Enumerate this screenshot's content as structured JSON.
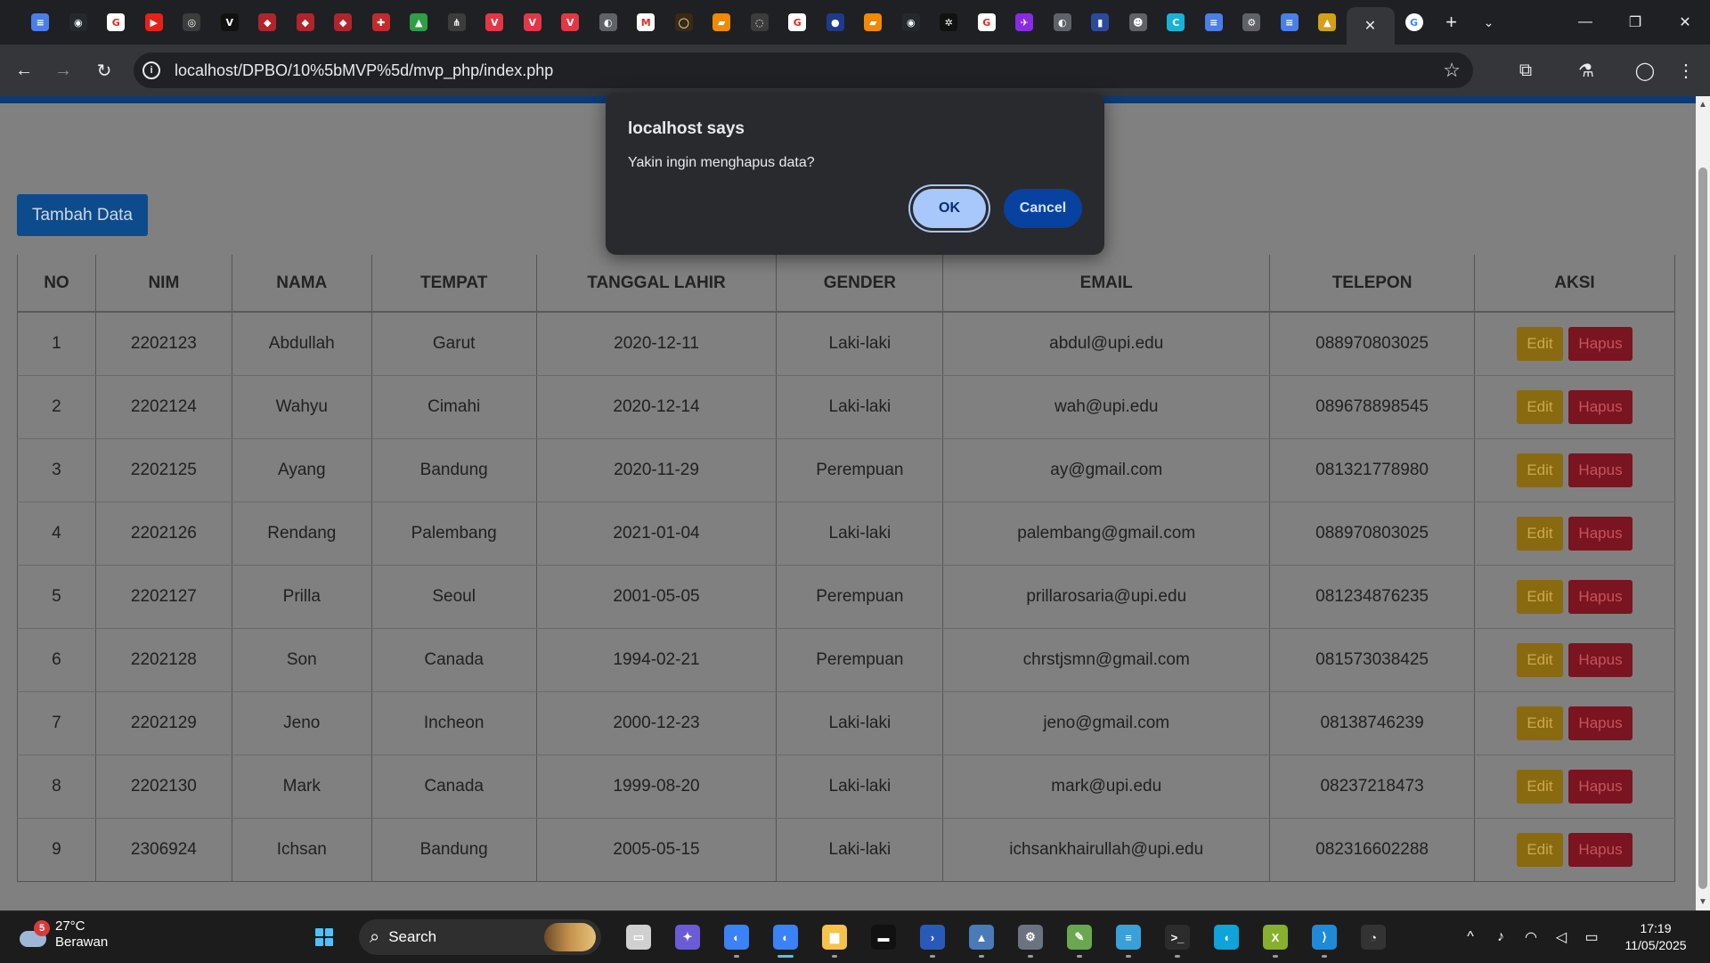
{
  "browser": {
    "tab_favicons": [
      {
        "name": "docs-tab",
        "color": "#4a7ee8",
        "glyph": "≡"
      },
      {
        "name": "github-tab",
        "color": "#24292e",
        "glyph": "◉"
      },
      {
        "name": "google-tab",
        "color": "#ffffff",
        "glyph": "G"
      },
      {
        "name": "youtube-tab",
        "color": "#e62117",
        "glyph": "▶"
      },
      {
        "name": "gray-circle-tab",
        "color": "#3c3c3c",
        "glyph": "◎"
      },
      {
        "name": "vo-tab",
        "color": "#111111",
        "glyph": "V"
      },
      {
        "name": "upi-tab-1",
        "color": "#b0242c",
        "glyph": "◆"
      },
      {
        "name": "upi-tab-2",
        "color": "#b0242c",
        "glyph": "◆"
      },
      {
        "name": "upi-tab-3",
        "color": "#b0242c",
        "glyph": "◆"
      },
      {
        "name": "gift-tab",
        "color": "#c22b2b",
        "glyph": "✚"
      },
      {
        "name": "drive-tab",
        "color": "#2f9e44",
        "glyph": "▲"
      },
      {
        "name": "graph-tab",
        "color": "#3c3c3c",
        "glyph": "⋔"
      },
      {
        "name": "v-red-tab-1",
        "color": "#e23744",
        "glyph": "V"
      },
      {
        "name": "v-red-tab-2",
        "color": "#e23744",
        "glyph": "V"
      },
      {
        "name": "v-red-tab-3",
        "color": "#e23744",
        "glyph": "V"
      },
      {
        "name": "globe-tab",
        "color": "#5f6368",
        "glyph": "◐"
      },
      {
        "name": "gmail-tab",
        "color": "#ffffff",
        "glyph": "M"
      },
      {
        "name": "orange-ring-tab",
        "color": "#3a2a10",
        "glyph": "◯"
      },
      {
        "name": "orange-tab-1",
        "color": "#f08a00",
        "glyph": "▰"
      },
      {
        "name": "ring-tab",
        "color": "#3c3c3c",
        "glyph": "◌"
      },
      {
        "name": "google-tab-2",
        "color": "#ffffff",
        "glyph": "G"
      },
      {
        "name": "blue-circle-tab",
        "color": "#1e3a8a",
        "glyph": "●"
      },
      {
        "name": "orange-tab-2",
        "color": "#f08a00",
        "glyph": "▰"
      },
      {
        "name": "github-tab-2",
        "color": "#24292e",
        "glyph": "◉"
      },
      {
        "name": "openai-tab",
        "color": "#111111",
        "glyph": "✲"
      },
      {
        "name": "google-tab-3",
        "color": "#ffffff",
        "glyph": "G"
      },
      {
        "name": "bird-tab",
        "color": "#8a2be2",
        "glyph": "✈"
      },
      {
        "name": "globe-tab-2",
        "color": "#5f6368",
        "glyph": "◐"
      },
      {
        "name": "split-tab",
        "color": "#2b4a9b",
        "glyph": "▮"
      },
      {
        "name": "cat-tab",
        "color": "#5f6368",
        "glyph": "☻"
      },
      {
        "name": "canva-tab",
        "color": "#19b2d6",
        "glyph": "C"
      },
      {
        "name": "docs-tab-2",
        "color": "#4a7ee8",
        "glyph": "≡"
      },
      {
        "name": "settings-tab",
        "color": "#5f6368",
        "glyph": "⚙"
      },
      {
        "name": "docs-tab-3",
        "color": "#4a7ee8",
        "glyph": "≡"
      },
      {
        "name": "warning-tab",
        "color": "#d4a017",
        "glyph": "▲"
      }
    ],
    "active_tab_close": "✕",
    "after_tab_glyph": "G",
    "new_tab": "+",
    "tab_search": "⌄",
    "win_min": "—",
    "win_max": "❐",
    "win_close": "✕",
    "url": "localhost/DPBO/10%5bMVP%5d/mvp_php/index.php",
    "back": "←",
    "forward": "→",
    "reload": "↻",
    "star": "☆",
    "extensions": "⧉",
    "labs": "⚗",
    "profile": "◯",
    "menu": "⋮"
  },
  "page": {
    "add_button": "Tambah Data",
    "headers": [
      "NO",
      "NIM",
      "NAMA",
      "TEMPAT",
      "TANGGAL LAHIR",
      "GENDER",
      "EMAIL",
      "TELEPON",
      "AKSI"
    ],
    "rows": [
      [
        "1",
        "2202123",
        "Abdullah",
        "Garut",
        "2020-12-11",
        "Laki-laki",
        "abdul@upi.edu",
        "088970803025"
      ],
      [
        "2",
        "2202124",
        "Wahyu",
        "Cimahi",
        "2020-12-14",
        "Laki-laki",
        "wah@upi.edu",
        "089678898545"
      ],
      [
        "3",
        "2202125",
        "Ayang",
        "Bandung",
        "2020-11-29",
        "Perempuan",
        "ay@gmail.com",
        "081321778980"
      ],
      [
        "4",
        "2202126",
        "Rendang",
        "Palembang",
        "2021-01-04",
        "Laki-laki",
        "palembang@gmail.com",
        "088970803025"
      ],
      [
        "5",
        "2202127",
        "Prilla",
        "Seoul",
        "2001-05-05",
        "Perempuan",
        "prillarosaria@upi.edu",
        "081234876235"
      ],
      [
        "6",
        "2202128",
        "Son",
        "Canada",
        "1994-02-21",
        "Perempuan",
        "chrstjsmn@gmail.com",
        "081573038425"
      ],
      [
        "7",
        "2202129",
        "Jeno",
        "Incheon",
        "2000-12-23",
        "Laki-laki",
        "jeno@gmail.com",
        "08138746239"
      ],
      [
        "8",
        "2202130",
        "Mark",
        "Canada",
        "1999-08-20",
        "Laki-laki",
        "mark@upi.edu",
        "08237218473"
      ],
      [
        "9",
        "2306924",
        "Ichsan",
        "Bandung",
        "2005-05-15",
        "Laki-laki",
        "ichsankhairullah@upi.edu",
        "082316602288"
      ]
    ],
    "edit_label": "Edit",
    "delete_label": "Hapus"
  },
  "dialog": {
    "title": "localhost says",
    "message": "Yakin ingin menghapus data?",
    "ok": "OK",
    "cancel": "Cancel"
  },
  "taskbar": {
    "weather_badge": "5",
    "temperature": "27°C",
    "condition": "Berawan",
    "search": "Search",
    "apps": [
      {
        "name": "task-view",
        "color": "#d0d0d0",
        "glyph": "▭",
        "dot": false
      },
      {
        "name": "copilot",
        "color": "#6b5bd6",
        "glyph": "✦",
        "dot": false
      },
      {
        "name": "chrome-profile-1",
        "color": "#3b82f6",
        "glyph": "◐",
        "dot": true
      },
      {
        "name": "chrome-profile-2",
        "color": "#3b82f6",
        "glyph": "◐",
        "dot": true,
        "active": true
      },
      {
        "name": "file-explorer",
        "color": "#f5c24b",
        "glyph": "▆",
        "dot": true
      },
      {
        "name": "terminal-black",
        "color": "#111111",
        "glyph": "▬",
        "dot": false
      },
      {
        "name": "powershell",
        "color": "#2a5ab8",
        "glyph": "›",
        "dot": true
      },
      {
        "name": "task-manager",
        "color": "#4a7ab8",
        "glyph": "▲",
        "dot": true
      },
      {
        "name": "settings",
        "color": "#6b7280",
        "glyph": "⚙",
        "dot": true
      },
      {
        "name": "notepad-plus",
        "color": "#6aa84f",
        "glyph": "✎",
        "dot": true
      },
      {
        "name": "notepad",
        "color": "#3aa0d8",
        "glyph": "≡",
        "dot": true
      },
      {
        "name": "cmd",
        "color": "#2c2c2c",
        "glyph": ">_",
        "dot": true
      },
      {
        "name": "edge",
        "color": "#0fa3d8",
        "glyph": "◖",
        "dot": false
      },
      {
        "name": "xampp",
        "color": "#86b02e",
        "glyph": "X",
        "dot": true
      },
      {
        "name": "vscode",
        "color": "#1f8ad8",
        "glyph": "⟩",
        "dot": true
      },
      {
        "name": "app-red-dot",
        "color": "#333333",
        "glyph": "◔",
        "dot": false
      }
    ],
    "tray_chevron": "^",
    "mic": "♪",
    "wifi": "◠",
    "volume": "◁",
    "battery": "▭",
    "time": "17:19",
    "date": "11/05/2025"
  }
}
